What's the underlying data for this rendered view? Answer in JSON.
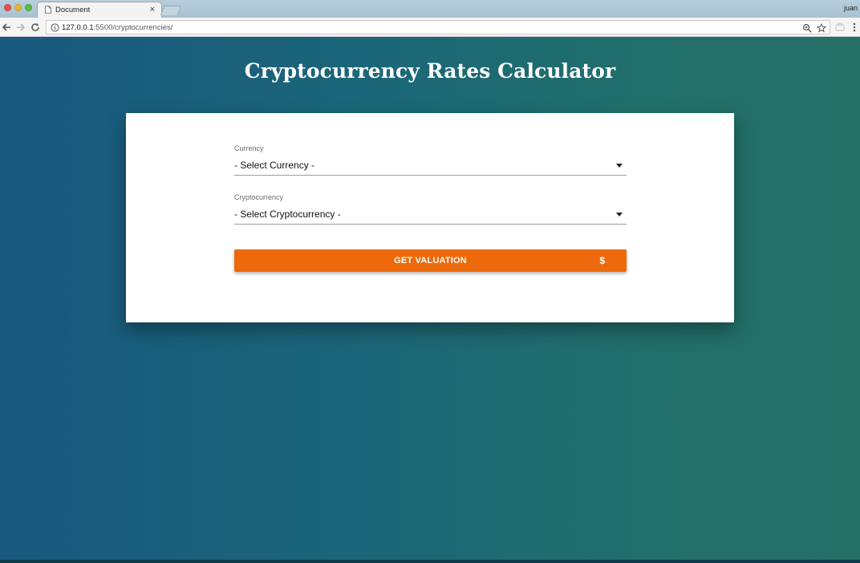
{
  "browser": {
    "tab_title": "Document",
    "tab_close": "×",
    "profile_name": "juan",
    "url_host": "127.0.0.1",
    "url_rest": ":5500/cryptocurrencies/"
  },
  "page": {
    "title": "Cryptocurrency Rates Calculator"
  },
  "form": {
    "currency": {
      "label": "Currency",
      "selected": "- Select Currency -"
    },
    "cryptocurrency": {
      "label": "Cryptocurrency",
      "selected": "- Select Cryptocurrency -"
    },
    "submit": {
      "label": "GET VALUATION",
      "icon_glyph": "$"
    }
  },
  "colors": {
    "accent_button": "#ec6a0c",
    "background_start": "#18587e",
    "background_end": "#246f66"
  }
}
